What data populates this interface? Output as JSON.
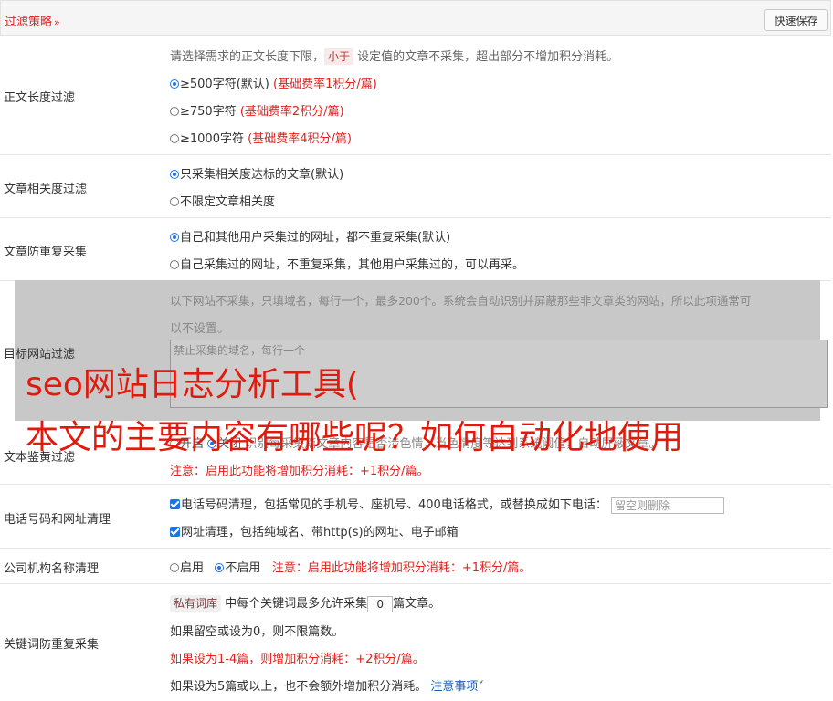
{
  "header": {
    "title": "过滤策略",
    "chevron": "chevron-down-icon",
    "save_label": "快速保存"
  },
  "length_filter": {
    "label": "正文长度过滤",
    "desc_before": "请选择需求的正文长度下限，",
    "desc_tag": "小于",
    "desc_after": "设定值的文章不采集，超出部分不增加积分消耗。",
    "options": [
      {
        "label": "≥500字符(默认)",
        "note": "(基础费率1积分/篇)",
        "checked": true
      },
      {
        "label": "≥750字符",
        "note": "(基础费率2积分/篇)",
        "checked": false
      },
      {
        "label": "≥1000字符",
        "note": "(基础费率4积分/篇)",
        "checked": false
      }
    ]
  },
  "relevance": {
    "label": "文章相关度过滤",
    "options": [
      {
        "label": "只采集相关度达标的文章(默认)",
        "checked": true
      },
      {
        "label": "不限定文章相关度",
        "checked": false
      }
    ]
  },
  "dedupe": {
    "label": "文章防重复采集",
    "options": [
      {
        "label": "自己和其他用户采集过的网址，都不重复采集(默认)",
        "checked": true
      },
      {
        "label": "自己采集过的网址，不重复采集，其他用户采集过的，可以再采。",
        "checked": false
      }
    ]
  },
  "target_site": {
    "label": "目标网站过滤",
    "desc_line1": "以下网站不采集，只填域名，每行一个，最多200个。系统会自动识别并屏蔽那些非文章类的网站，所以此项通常可",
    "desc_line2": "以不设置。",
    "placeholder": "禁止采集的域名，每行一个"
  },
  "porn_filter": {
    "label": "文本鉴黄过滤",
    "opt_on": "开启",
    "opt_off": "关闭",
    "desc": "识别每采集篇文章内容是否涉色情，当色情度等达到系统阈值，自动屏蔽文章。",
    "note": "注意：启用此功能将增加积分消耗：+1积分/篇。"
  },
  "phone_clean": {
    "label": "电话号码和网址清理",
    "phone_text": "电话号码清理，包括常见的手机号、座机号、400电话格式，或替换成如下电话：",
    "phone_placeholder": "留空则删除",
    "url_text": "网址清理，包括纯域名、带http(s)的网址、电子邮箱"
  },
  "company_clean": {
    "label": "公司机构名称清理",
    "opt_on": "启用",
    "opt_off": "不启用",
    "note": "注意：启用此功能将增加积分消耗：+1积分/篇。"
  },
  "keyword_dedupe": {
    "label": "关键词防重复采集",
    "tag": "私有词库",
    "text_before": "中每个关键词最多允许采集",
    "value": "0",
    "text_after": "篇文章。",
    "line2": "如果留空或设为0，则不限篇数。",
    "line3": "如果设为1-4篇，则增加积分消耗：+2积分/篇。",
    "line4": "如果设为5篇或以上，也不会额外增加积分消耗。",
    "link": "注意事项"
  },
  "overlay": {
    "line1": "seo网站日志分析工具(",
    "line2": "本文的主要内容有哪些呢？如何自动化地使用"
  }
}
